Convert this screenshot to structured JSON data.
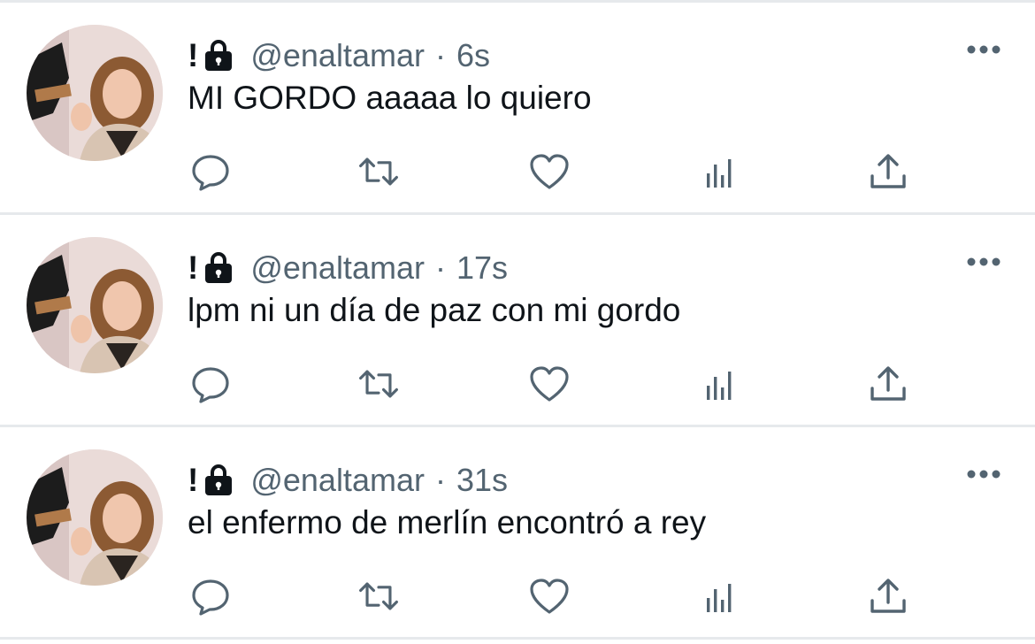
{
  "tweets": [
    {
      "display_name": "!",
      "handle": "@enaltamar",
      "separator": "·",
      "time": "6s",
      "text": "MI GORDO aaaaa lo quiero"
    },
    {
      "display_name": "!",
      "handle": "@enaltamar",
      "separator": "·",
      "time": "17s",
      "text": "lpm ni un día de paz con mi gordo"
    },
    {
      "display_name": "!",
      "handle": "@enaltamar",
      "separator": "·",
      "time": "31s",
      "text": "el enfermo de merlín encontró a rey"
    }
  ],
  "icons": {
    "protected": "lock-icon",
    "more": "more-icon",
    "reply": "reply-icon",
    "retweet": "retweet-icon",
    "like": "heart-icon",
    "views": "views-icon",
    "share": "share-icon"
  },
  "colors": {
    "text_primary": "#0f1419",
    "text_secondary": "#536471",
    "divider": "#e6e9ec"
  }
}
